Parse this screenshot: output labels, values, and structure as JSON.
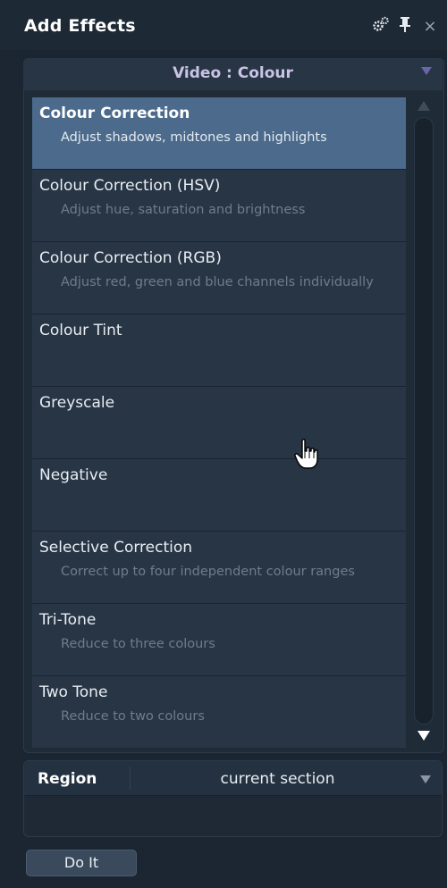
{
  "window": {
    "title": "Add Effects",
    "icons": [
      "gears-icon",
      "pin-icon",
      "close-icon"
    ]
  },
  "category": {
    "label": "Video : Colour"
  },
  "effects": [
    {
      "title": "Colour Correction",
      "description": "Adjust shadows, midtones and highlights",
      "selected": true
    },
    {
      "title": "Colour Correction (HSV)",
      "description": "Adjust hue, saturation and brightness",
      "selected": false
    },
    {
      "title": "Colour Correction (RGB)",
      "description": "Adjust red, green and blue channels individually",
      "selected": false
    },
    {
      "title": "Colour Tint",
      "description": "",
      "selected": false
    },
    {
      "title": "Greyscale",
      "description": "",
      "selected": false
    },
    {
      "title": "Negative",
      "description": "",
      "selected": false
    },
    {
      "title": "Selective Correction",
      "description": "Correct up to four independent colour ranges",
      "selected": false
    },
    {
      "title": "Tri-Tone",
      "description": "Reduce to three colours",
      "selected": false
    },
    {
      "title": "Two Tone",
      "description": "Reduce to two colours",
      "selected": false
    }
  ],
  "region": {
    "label": "Region",
    "value": "current section"
  },
  "actions": {
    "do_it_label": "Do It"
  },
  "colors": {
    "background": "#1c2633",
    "selected_row": "#4b6a8c",
    "category_accent": "#6a66a8"
  }
}
